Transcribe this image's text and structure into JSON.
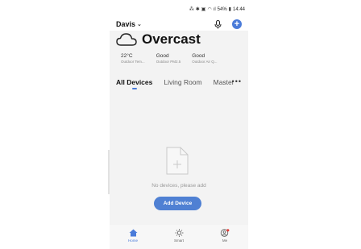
{
  "status": {
    "battery_percent": "54%",
    "time": "14:44"
  },
  "header": {
    "home_name": "Davis"
  },
  "weather": {
    "condition": "Overcast",
    "metrics": [
      {
        "value": "22°C",
        "label": "Outdoor Tem..."
      },
      {
        "value": "Good",
        "label": "Outdoor PM2.5"
      },
      {
        "value": "Good",
        "label": "Outdoor Air Q..."
      }
    ]
  },
  "tabs": [
    "All Devices",
    "Living Room",
    "Master"
  ],
  "empty": {
    "message": "No devices, please add",
    "button_label": "Add Device"
  },
  "bottom_nav": [
    "Home",
    "Smart",
    "Me"
  ],
  "colors": {
    "accent": "#4a7bd9",
    "badge": "#e53935"
  }
}
